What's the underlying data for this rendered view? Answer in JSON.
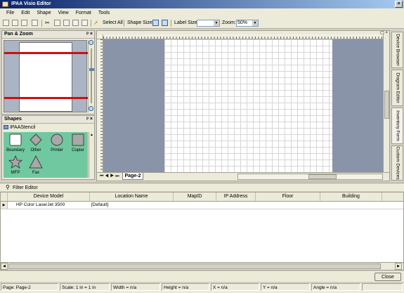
{
  "window": {
    "title": "IPAA Visio Editor",
    "close_glyph": "×"
  },
  "menu": [
    "File",
    "Edit",
    "Shape",
    "View",
    "Format",
    "Tools"
  ],
  "toolbar": {
    "select_all": "Select All",
    "shape_size_label": "Shape Size:",
    "label_size_label": "Label Size:",
    "label_size_value": "",
    "zoom_label": "Zoom:",
    "zoom_value": "50%"
  },
  "pan_zoom": {
    "title": "Pan & Zoom",
    "pin_glyph": "ᵖ",
    "close_glyph": "×"
  },
  "shapes_panel": {
    "title": "Shapes",
    "stencil_name": "IPAAStencil",
    "items": [
      {
        "label": "Boundary",
        "icon": "boundary-icon"
      },
      {
        "label": "Other",
        "icon": "diamond-icon"
      },
      {
        "label": "Printer",
        "icon": "circle-icon"
      },
      {
        "label": "Copier",
        "icon": "square-icon"
      },
      {
        "label": "MFP",
        "icon": "star-icon"
      },
      {
        "label": "Fax",
        "icon": "triangle-icon"
      }
    ]
  },
  "page_tabs": {
    "active": "Page-2"
  },
  "side_tabs": [
    "Device Browser",
    "Diagram Editor",
    "Inventory Form",
    "Custom Devices"
  ],
  "filter_editor": {
    "label": "Filter Editor"
  },
  "grid": {
    "columns": [
      "Device Model",
      "Location Name",
      "MapID",
      "IP Address",
      "Floor",
      "Building"
    ],
    "rows": [
      {
        "device_model": "HP Color LaserJet 3500",
        "location_name": "[Default]",
        "map_id": "",
        "ip_address": "",
        "floor": "",
        "building": ""
      }
    ]
  },
  "buttons": {
    "close": "Close"
  },
  "status": {
    "page": "Page: Page-2",
    "scale": "Scale: 1 in = 1 in",
    "width": "Width = n/a",
    "height": "Height = n/a",
    "x": "X = n/a",
    "y": "Y = n/a",
    "angle": "Angle = n/a"
  },
  "colors": {
    "titlebar_start": "#0a246a",
    "stencil_bg": "#70c8a0",
    "canvas_bg": "#8a94a8",
    "redline": "#cc1010"
  }
}
